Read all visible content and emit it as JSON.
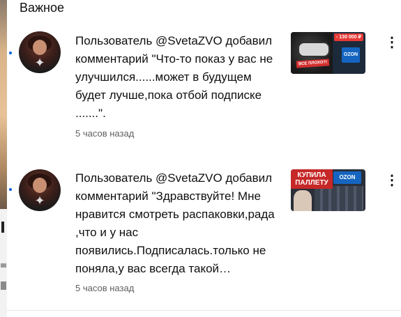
{
  "header": {
    "title": "Важное"
  },
  "notifications": [
    {
      "text": "Пользователь @SvetaZVO добавил комментарий \"Что-то показ у вас не улучшился......может в будущем будет лучше,пока отбой подписке .......\".",
      "time": "5 часов назад",
      "thumbnail": {
        "price": "- 130 000 ₽",
        "brand": "OZON",
        "caption": "ВСЕ ПЛОХО?!"
      }
    },
    {
      "text": "Пользователь @SvetaZVO добавил комментарий \"Здравствуйте! Мне нравится смотреть распаковки,рада ,что и у нас появились.Подписалась.только не поняла,у вас всегда такой…",
      "time": "5 часов назад",
      "thumbnail": {
        "banner": "КУПИЛА ПАЛЛЕТУ",
        "brand": "OZON"
      }
    }
  ],
  "menu_glyph": "⋮",
  "colors": {
    "unread_dot": "#065fd4",
    "text": "#0f0f0f",
    "secondary_text": "#606060"
  }
}
